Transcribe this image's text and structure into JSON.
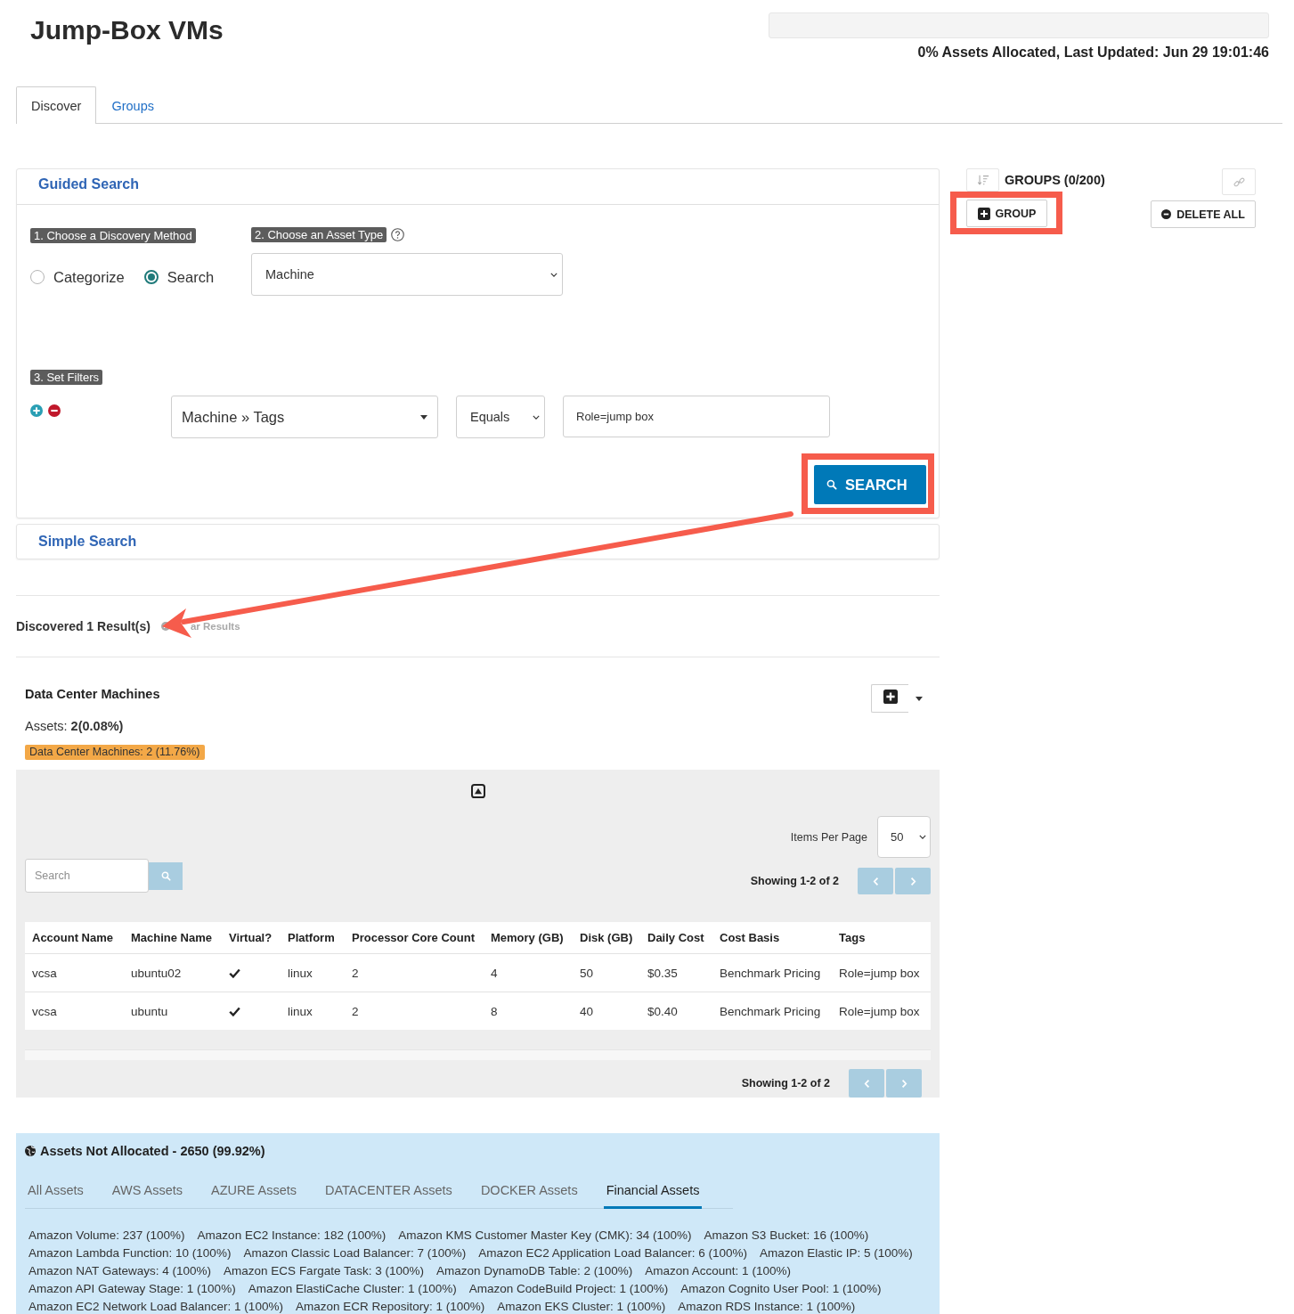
{
  "header": {
    "title": "Jump-Box VMs",
    "allocation": {
      "level": 0,
      "summary": "0% Assets Allocated, Last Updated: Jun 29 19:01:46"
    }
  },
  "tabs": [
    {
      "label": "Discover",
      "selected": true
    },
    {
      "label": "Groups",
      "selected": false
    }
  ],
  "guided_search": {
    "title": "Guided Search",
    "method": {
      "label": "1. Choose a Discovery Method",
      "options": [
        {
          "label": "Categorize",
          "selected": false
        },
        {
          "label": "Search",
          "selected": true
        }
      ]
    },
    "asset_type": {
      "label": "2. Choose an Asset Type",
      "value": "Machine"
    },
    "filters": {
      "label": "3. Set Filters",
      "rows": [
        {
          "field": "Machine » Tags",
          "operator": "Equals",
          "value": "Role=jump box"
        }
      ]
    },
    "search_button": {
      "label": "SEARCH",
      "highlighted": true
    }
  },
  "simple_search": {
    "title": "Simple Search"
  },
  "results": {
    "summary": "Discovered 1 Result(s)",
    "clear_link": "ar Results"
  },
  "result_group": {
    "title": "Data Center Machines",
    "assets": "Assets: **2(0.08%)**",
    "tag": "Data Center Machines: 2 (11.76%)",
    "items_per_page": {
      "label": "Items Per Page",
      "value": "50"
    },
    "search": {
      "placeholder": "Search"
    },
    "pager_top": "Showing 1-2 of 2",
    "table": {
      "columns": [
        "Account Name",
        "Machine Name",
        "Virtual?",
        "Platform",
        "Processor Core Count",
        "Memory (GB)",
        "Disk (GB)",
        "Daily Cost",
        "Cost Basis",
        "Tags"
      ],
      "rows": [
        {
          "cells": [
            {
              "kind": "text",
              "text": "vcsa"
            },
            {
              "kind": "text",
              "text": "ubuntu02"
            },
            {
              "kind": "check",
              "checked": true
            },
            {
              "kind": "text",
              "text": "linux"
            },
            {
              "kind": "text",
              "text": "2"
            },
            {
              "kind": "text",
              "text": "4"
            },
            {
              "kind": "text",
              "text": "50"
            },
            {
              "kind": "text",
              "text": "$0.35"
            },
            {
              "kind": "text",
              "text": "Benchmark Pricing"
            },
            {
              "kind": "text",
              "text": "Role=jump box"
            }
          ]
        },
        {
          "cells": [
            {
              "kind": "text",
              "text": "vcsa"
            },
            {
              "kind": "text",
              "text": "ubuntu"
            },
            {
              "kind": "check",
              "checked": true
            },
            {
              "kind": "text",
              "text": "linux"
            },
            {
              "kind": "text",
              "text": "2"
            },
            {
              "kind": "text",
              "text": "8"
            },
            {
              "kind": "text",
              "text": "40"
            },
            {
              "kind": "text",
              "text": "$0.40"
            },
            {
              "kind": "text",
              "text": "Benchmark Pricing"
            },
            {
              "kind": "text",
              "text": "Role=jump box"
            }
          ]
        }
      ]
    },
    "pager_bottom": "Showing 1-2 of 2"
  },
  "unallocated": {
    "title": "Assets Not Allocated - 2650 (99.92%)",
    "tabs": [
      {
        "label": "All Assets",
        "selected": false
      },
      {
        "label": "AWS Assets",
        "selected": false
      },
      {
        "label": "AZURE Assets",
        "selected": false
      },
      {
        "label": "DATACENTER Assets",
        "selected": false
      },
      {
        "label": "DOCKER Assets",
        "selected": false
      },
      {
        "label": "Financial Assets",
        "selected": true
      }
    ],
    "items": [
      "Amazon Volume: 237 (100%)",
      "Amazon EC2 Instance: 182 (100%)",
      "Amazon KMS Customer Master Key (CMK): 34 (100%)",
      "Amazon S3 Bucket: 16 (100%)",
      "Amazon Lambda Function: 10 (100%)",
      "Amazon Classic Load Balancer: 7 (100%)",
      "Amazon EC2 Application Load Balancer: 6 (100%)",
      "Amazon Elastic IP: 5 (100%)",
      "Amazon NAT Gateways: 4 (100%)",
      "Amazon ECS Fargate Task: 3 (100%)",
      "Amazon DynamoDB Table: 2 (100%)",
      "Amazon Account: 1 (100%)",
      "Amazon API Gateway Stage: 1 (100%)",
      "Amazon ElastiCache Cluster: 1 (100%)",
      "Amazon CodeBuild Project: 1 (100%)",
      "Amazon Cognito User Pool: 1 (100%)",
      "Amazon EC2 Network Load Balancer: 1 (100%)",
      "Amazon ECR Repository: 1 (100%)",
      "Amazon EKS Cluster: 1 (100%)",
      "Amazon RDS Instance: 1 (100%)"
    ]
  },
  "groups_panel": {
    "title": "GROUPS (0/200)",
    "add_button": {
      "label": "GROUP",
      "highlighted": true
    },
    "delete_button": {
      "label": "DELETE ALL"
    }
  }
}
